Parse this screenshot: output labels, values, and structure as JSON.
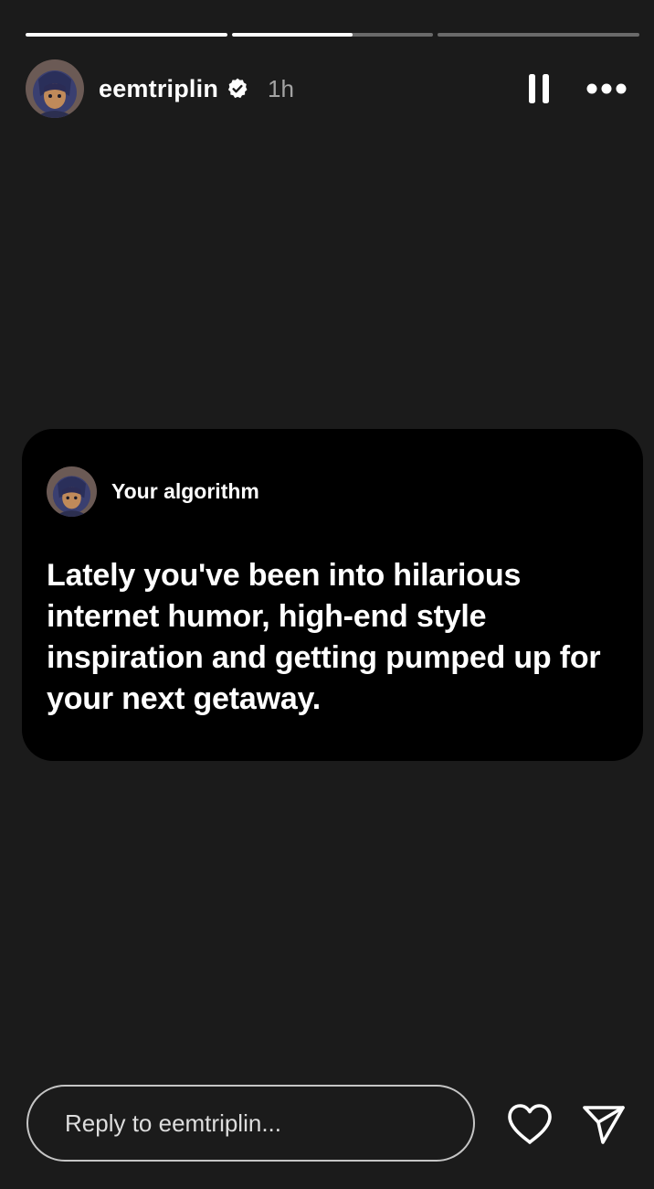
{
  "progress": {
    "segments": [
      {
        "fill": 1.0
      },
      {
        "fill": 0.6
      },
      {
        "fill": 0.0
      }
    ]
  },
  "header": {
    "username": "eemtriplin",
    "verified_icon": "verified-badge-icon",
    "time_ago": "1h",
    "pause_icon": "pause-icon",
    "more_icon": "more-horizontal-icon"
  },
  "card": {
    "title": "Your algorithm",
    "body": "Lately you've been into hilarious internet humor, high-end style inspiration and getting pumped up for your next getaway."
  },
  "footer": {
    "reply_placeholder": "Reply to eemtriplin...",
    "like_icon": "heart-icon",
    "send_icon": "send-icon"
  },
  "colors": {
    "background": "#1b1b1b",
    "card": "#000000",
    "text": "#ffffff"
  }
}
